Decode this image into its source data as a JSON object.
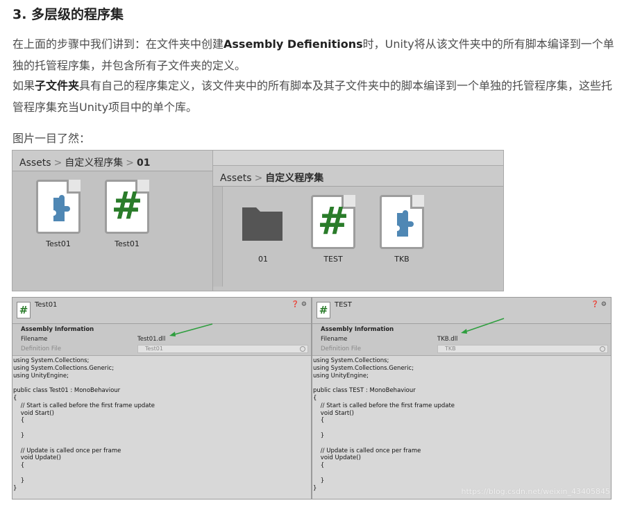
{
  "article": {
    "heading": "3. 多层级的程序集",
    "p1_pre": "在上面的步骤中我们讲到：在文件夹中创建",
    "p1_bold": "Assembly Defienitions",
    "p1_post": "时，Unity将从该文件夹中的所有脚本编译到一个单独的托管程序集，并包含所有子文件夹的定义。",
    "p2_pre": "如果",
    "p2_bold": "子文件夹",
    "p2_post": "具有自己的程序集定义，该文件夹中的所有脚本及其子文件夹中的脚本编译到一个单独的托管程序集，这些托管程序集充当Unity项目中的单个库。",
    "p3": "图片一目了然："
  },
  "left_project": {
    "crumbs": [
      "Assets",
      "自定义程序集",
      "01"
    ],
    "items": [
      {
        "label": "Test01",
        "icon": "assembly-definition-icon"
      },
      {
        "label": "Test01",
        "icon": "csharp-script-icon"
      }
    ]
  },
  "right_project": {
    "crumbs": [
      "Assets",
      "自定义程序集"
    ],
    "items": [
      {
        "label": "01",
        "icon": "folder-icon"
      },
      {
        "label": "TEST",
        "icon": "csharp-script-icon"
      },
      {
        "label": "TKB",
        "icon": "assembly-definition-icon"
      }
    ]
  },
  "inspectors": [
    {
      "title": "Test01",
      "controls": "❓ ⚙",
      "section": "Assembly Information",
      "filename_label": "Filename",
      "filename_value": "Test01.dll",
      "definition_label": "Definition File",
      "definition_value": "Test01",
      "code": "using System.Collections;\nusing System.Collections.Generic;\nusing UnityEngine;\n\npublic class Test01 : MonoBehaviour\n{\n    // Start is called before the first frame update\n    void Start()\n    {\n\n    }\n\n    // Update is called once per frame\n    void Update()\n    {\n\n    }\n}"
    },
    {
      "title": "TEST",
      "controls": "❓ ⚙",
      "section": "Assembly Information",
      "filename_label": "Filename",
      "filename_value": "TKB.dll",
      "definition_label": "Definition File",
      "definition_value": "TKB",
      "code": "using System.Collections;\nusing System.Collections.Generic;\nusing UnityEngine;\n\npublic class TEST : MonoBehaviour\n{\n    // Start is called before the first frame update\n    void Start()\n    {\n\n    }\n\n    // Update is called once per frame\n    void Update()\n    {\n\n    }\n}"
    }
  ],
  "colors": {
    "arrow": "#2e9e3e",
    "csharp": "#2a7c2a",
    "puzzle": "#4f87b4",
    "folder": "#555555"
  },
  "watermark": "https://blog.csdn.net/weixin_43405845"
}
